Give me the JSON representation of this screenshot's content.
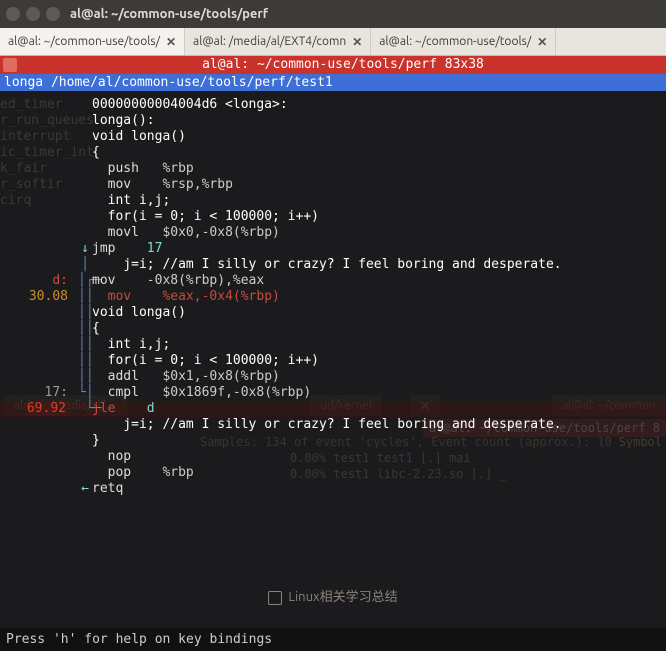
{
  "window": {
    "title": "al@al: ~/common-use/tools/perf"
  },
  "tabs": [
    {
      "label": "al@al: ~/common-use/tools/",
      "close": "✕",
      "active": true
    },
    {
      "label": "al@al: /media/al/EXT4/comn",
      "close": "✕",
      "active": false
    },
    {
      "label": "al@al: ~/common-use/tools/",
      "close": "✕",
      "active": false
    }
  ],
  "banner": {
    "red": "al@al: ~/common-use/tools/perf 83x38",
    "blue_fn": "longa",
    "blue_path": "/home/al/common-use/tools/perf/test1"
  },
  "percentages": {
    "line_mov_eax": "30.08",
    "line_jle": "69.92"
  },
  "labels": {
    "d": "d:",
    "seventeen": "17:"
  },
  "code": {
    "addr": "00000000004004d6 <longa>:",
    "fn1": "longa():",
    "decl": "void longa()",
    "brace_open": "{",
    "push": {
      "mn": "push",
      "op": "%rbp"
    },
    "mov_rsp": {
      "mn": "mov",
      "op": "%rsp,%rbp"
    },
    "int_ij": "int i,j;",
    "for": "for(i = 0; i < 100000; i++)",
    "movl_0": {
      "mn": "movl",
      "op": "$0x0,-0x8(%rbp)"
    },
    "jmp17": {
      "arrow": "↓",
      "mn": "jmp",
      "op": "17"
    },
    "cmt1": "j=i; //am I silly or crazy? I feel boring and desperate.",
    "mov_rbp_eax": {
      "mn": "mov",
      "op": "-0x8(%rbp),%eax"
    },
    "mov_eax_rbp": {
      "mn": "mov",
      "op": "%eax,-0x4(%rbp)"
    },
    "addl": {
      "mn": "addl",
      "op": "$0x1,-0x8(%rbp)"
    },
    "cmpl": {
      "mn": "cmpl",
      "op": "$0x1869f,-0x8(%rbp)"
    },
    "jle": {
      "mn": "jle",
      "op": "d"
    },
    "cmt2": "j=i; //am I silly or crazy? I feel boring and desperate.",
    "brace_close": "}",
    "nop": {
      "mn": "nop"
    },
    "pop": {
      "mn": "pop",
      "op": "%rbp"
    },
    "retq": {
      "arrow": "←",
      "mn": "retq"
    }
  },
  "dim_sidebar": [
    "ed_timer",
    "r_run_queues",
    "interrupt",
    "ic_timer_int",
    "k_fair",
    "r_softir",
    "cirq"
  ],
  "ghost": {
    "tab_left": "al@al: /media/al/…",
    "tab_left_close": "✕",
    "tab_path_mid": "ud/kernel",
    "tab_right": "al@al: ~/common",
    "red_right": "al@al: ~/common-use/tools/perf 8",
    "samples": "Samples: 134  of event 'cycles', Event count (approx.): 10",
    "row1": "0.00%  test1    test1         [.] mai",
    "row2": "0.00%  test1    libc-2.23.so  [.] _",
    "symbol": "Symbol"
  },
  "checkbox_label": "Linux相关学习总结",
  "statusbar": "Press 'h' for help on key bindings"
}
